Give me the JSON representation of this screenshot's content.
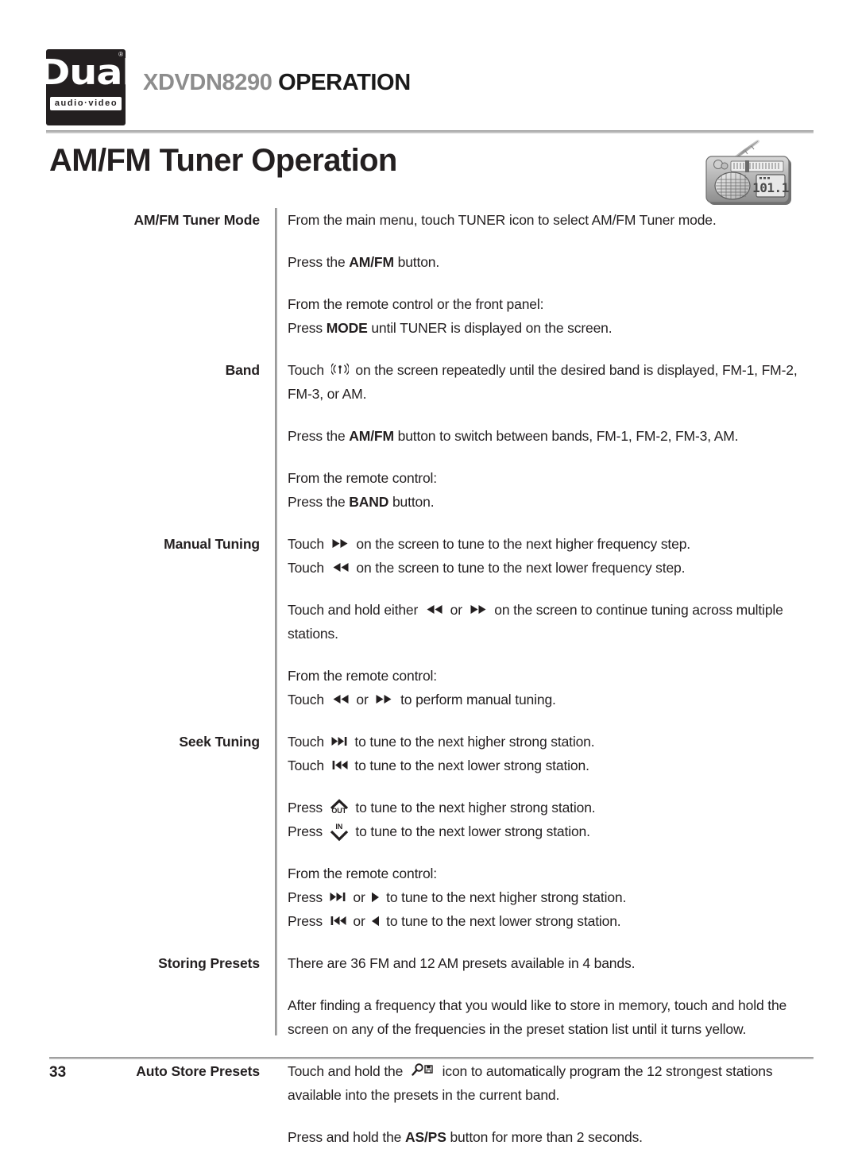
{
  "header": {
    "logo_word": "Dual",
    "logo_registered": "®",
    "logo_subtitle": "audio·video",
    "model": "XDVDN8290",
    "section_word": "OPERATION"
  },
  "page_title": "AM/FM Tuner Operation",
  "illustration": {
    "name": "portable-radio",
    "display_value": "101.1"
  },
  "sections": [
    {
      "label": "AM/FM Tuner Mode",
      "paragraphs": [
        "From the main menu, touch TUNER icon to select AM/FM Tuner mode.",
        "Press the AM/FM button.",
        "From the remote control or the front panel:",
        "Press MODE until TUNER is displayed on the screen."
      ]
    },
    {
      "label": "Band",
      "paragraphs": [
        "Touch [signal-icon] on the screen repeatedly until the desired band is displayed, FM-1, FM-2, FM-3, or AM.",
        "Press the AM/FM button to switch between bands, FM-1, FM-2, FM-3, AM.",
        "From the remote control:",
        "Press the BAND button."
      ]
    },
    {
      "label": "Manual Tuning",
      "paragraphs": [
        "Touch [fast-forward-icon] on the screen to tune to the next higher frequency step.",
        "Touch [rewind-icon] on the screen to tune to the next lower frequency step.",
        "Touch and hold either [rewind-icon] or [fast-forward-icon] on the screen to continue tuning across multiple stations.",
        "From the remote control:",
        "Touch [rewind-icon] or [fast-forward-icon] to perform manual tuning."
      ]
    },
    {
      "label": "Seek Tuning",
      "paragraphs": [
        "Touch [skip-forward-icon] to tune to the next higher strong station.",
        "Touch [skip-back-icon] to tune to the next lower strong station.",
        "Press [out-icon] to tune to the next higher strong station.",
        "Press [in-icon] to tune to the next lower strong station.",
        "From the remote control:",
        "Press [skip-forward-icon] or [play-right-icon] to tune to the next higher strong station.",
        "Press [skip-back-icon] or [play-left-icon] to tune to the next lower strong station."
      ]
    },
    {
      "label": "Storing Presets",
      "paragraphs": [
        "There are 36 FM and 12 AM presets available in 4 bands.",
        "After finding a frequency that you would like to store in memory, touch and hold the screen on any of the frequencies in the preset station list until it turns yellow."
      ]
    },
    {
      "label": "Auto Store Presets",
      "paragraphs": [
        "Touch and hold the [auto-store-icon] icon to automatically program the 12 strongest stations available into the presets in the current band.",
        "Press and hold the AS/PS button for more than 2 seconds."
      ]
    }
  ],
  "body": {
    "tuner_mode": {
      "p1": "From the main menu, touch TUNER icon to select AM/FM Tuner mode.",
      "p2_pre": "Press the ",
      "p2_bold": "AM/FM",
      "p2_post": " button.",
      "p3": "From the remote control or the front panel:",
      "p4_pre": "Press ",
      "p4_bold": "MODE",
      "p4_post": " until TUNER is displayed on the screen."
    },
    "band": {
      "p1_pre": "Touch ",
      "p1_post": " on the screen repeatedly until the desired band is displayed, FM-1, FM-2, FM-3, or AM.",
      "p2_pre": "Press the ",
      "p2_bold": "AM/FM",
      "p2_post": " button to switch between bands, FM-1, FM-2, FM-3, AM.",
      "p3": "From the remote control:",
      "p4_pre": "Press the ",
      "p4_bold": "BAND",
      "p4_post": " button."
    },
    "manual_tuning": {
      "l1_pre": "Touch ",
      "l1_post": " on the screen to tune to the next higher frequency step.",
      "l2_pre": "Touch ",
      "l2_post": " on the screen to tune to the next lower frequency step.",
      "l3_pre": "Touch and hold either ",
      "l3_mid": " or ",
      "l3_post": " on the screen to continue tuning across multiple stations.",
      "l4": "From the remote control:",
      "l5_pre": "Touch ",
      "l5_mid": " or ",
      "l5_post": " to perform manual tuning."
    },
    "seek_tuning": {
      "l1_pre": "Touch ",
      "l1_post": " to tune to the next higher strong station.",
      "l2_pre": "Touch ",
      "l2_post": " to tune to the next lower strong station.",
      "l3_pre": "Press ",
      "l3_post": " to tune to the next higher strong station.",
      "l4_pre": "Press ",
      "l4_post": " to tune to the next lower strong station.",
      "l5": "From the remote control:",
      "l6_pre": "Press ",
      "l6_mid": " or ",
      "l6_post": " to tune to the next higher strong station.",
      "l7_pre": "Press ",
      "l7_mid": " or ",
      "l7_post": " to tune to the next lower strong station.",
      "out_label": "OUT",
      "in_label": "IN"
    },
    "storing_presets": {
      "p1": "There are 36 FM and 12 AM presets available in 4 bands.",
      "p2": "After finding a frequency that you would like to store in memory, touch and hold the screen on any of the frequencies in the preset station list until it turns yellow."
    },
    "auto_store": {
      "p1_pre": "Touch and hold the ",
      "p1_post": " icon to automatically program the 12 strongest stations available into the presets in the current band.",
      "p2_pre": "Press and hold the ",
      "p2_bold": "AS/PS",
      "p2_post": " button for more than 2 seconds."
    }
  },
  "footer": {
    "page_number": "33"
  },
  "colors": {
    "text": "#231f20",
    "model_gray": "#8d8d8d",
    "rule": "#b5b5b5",
    "logo_bg": "#231f20"
  }
}
